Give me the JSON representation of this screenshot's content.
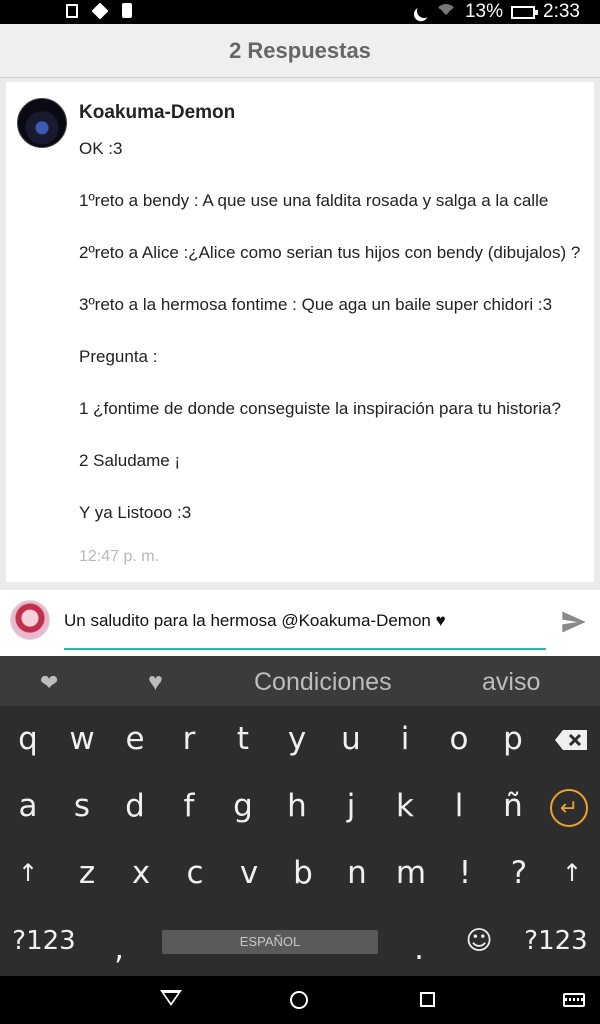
{
  "status_bar": {
    "battery_text": "13%",
    "time": "2:33"
  },
  "header": {
    "title": "2 Respuestas"
  },
  "post": {
    "username": "Koakuma-Demon",
    "paragraphs": [
      "OK :3",
      "1ºreto a bendy : A que use una faldita rosada y salga a la calle",
      "2ºreto a Alice :¿Alice como serian tus hijos con bendy (dibujalos) ?",
      "3ºreto a la hermosa fontime : Que aga un baile super chidori :3",
      "Pregunta :",
      "1 ¿fontime de donde conseguiste la inspiración para tu historia?",
      "2 Saludame ¡",
      "Y ya Listooo :3"
    ],
    "timestamp": "12:47 p. m."
  },
  "reply": {
    "value": "Un saludito para la hermosa @Koakuma-Demon ♥"
  },
  "keyboard": {
    "suggestions": [
      "❤",
      "♥",
      "Condiciones",
      "aviso"
    ],
    "row1": [
      "q",
      "w",
      "e",
      "r",
      "t",
      "y",
      "u",
      "i",
      "o",
      "p"
    ],
    "row2": [
      "a",
      "s",
      "d",
      "f",
      "g",
      "h",
      "j",
      "k",
      "l",
      "ñ"
    ],
    "row3": [
      "↑",
      "z",
      "x",
      "c",
      "v",
      "b",
      "n",
      "m",
      "!",
      "?",
      "↑"
    ],
    "row4": {
      "left": "?123",
      "comma": ",",
      "space": "ESPAÑOL",
      "period": ".",
      "emoji": "☺",
      "right": "?123"
    },
    "enter_glyph": "↵"
  }
}
